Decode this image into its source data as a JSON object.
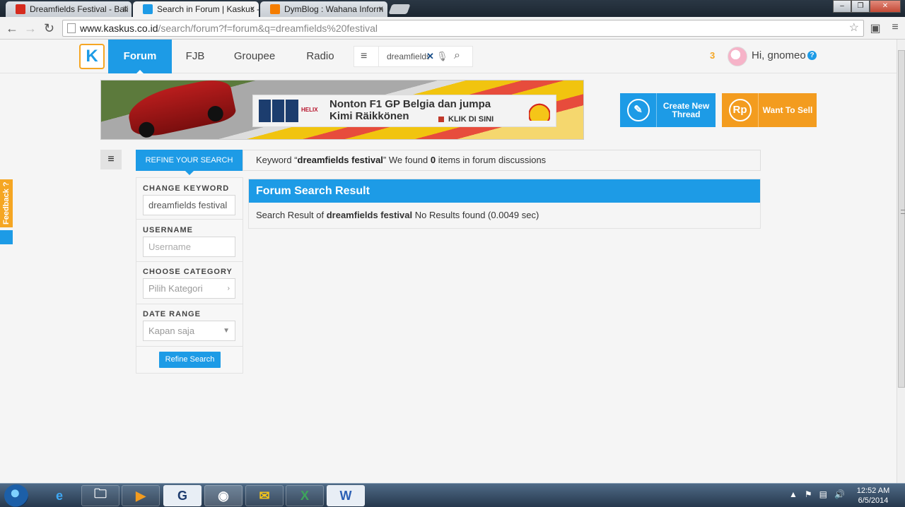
{
  "browser": {
    "tabs": [
      {
        "title": "Dreamfields Festival - Bali",
        "color": "#d62b1e"
      },
      {
        "title": "Search in Forum | Kaskus -",
        "color": "#1d9be6"
      },
      {
        "title": "DymBlog : Wahana Inform",
        "color": "#f57d00"
      }
    ],
    "close_glyph": "x",
    "url_host": "www.kaskus.co.id",
    "url_path": "/search/forum?f=forum&q=dreamfields%20festival"
  },
  "header": {
    "logo_letter": "K",
    "nav": [
      "Forum",
      "FJB",
      "Groupee",
      "Radio"
    ],
    "search_query": "dreamfields",
    "notification_count": "3",
    "greeting": "Hi, gnomeo",
    "help_glyph": "?"
  },
  "banner": {
    "line1": "Nonton F1 GP Belgia dan jumpa",
    "line2": "Kimi Räikkönen",
    "cta": "KLIK DI SINI",
    "brand": "HELIX"
  },
  "actions": {
    "create_label": "Create New Thread",
    "sell_icon": "Rp",
    "sell_label": "Want To Sell"
  },
  "feedback_label": "Feedback ?",
  "refine": {
    "header": "REFINE YOUR SEARCH",
    "change_keyword_label": "CHANGE KEYWORD",
    "keyword_value": "dreamfields festival",
    "username_label": "USERNAME",
    "username_placeholder": "Username",
    "category_label": "CHOOSE CATEGORY",
    "category_placeholder": "Pilih Kategori",
    "date_label": "DATE RANGE",
    "date_value": "Kapan saja",
    "button": "Refine Search"
  },
  "summary": {
    "prefix": "Keyword “",
    "keyword": "dreamfields festival",
    "middle": "” We found ",
    "count": "0",
    "suffix": " items in forum discussions"
  },
  "results": {
    "title": "Forum Search Result",
    "prefix": "Search Result of ",
    "keyword": "dreamfields festival",
    "suffix": " No Results found (0.0049 sec)"
  },
  "taskbar": {
    "apps": [
      "ie-icon",
      "explorer-icon",
      "media-player-icon",
      "app-g-icon",
      "chrome-icon",
      "outlook-icon",
      "excel-icon",
      "word-icon"
    ],
    "time": "12:52 AM",
    "date": "6/5/2014"
  }
}
